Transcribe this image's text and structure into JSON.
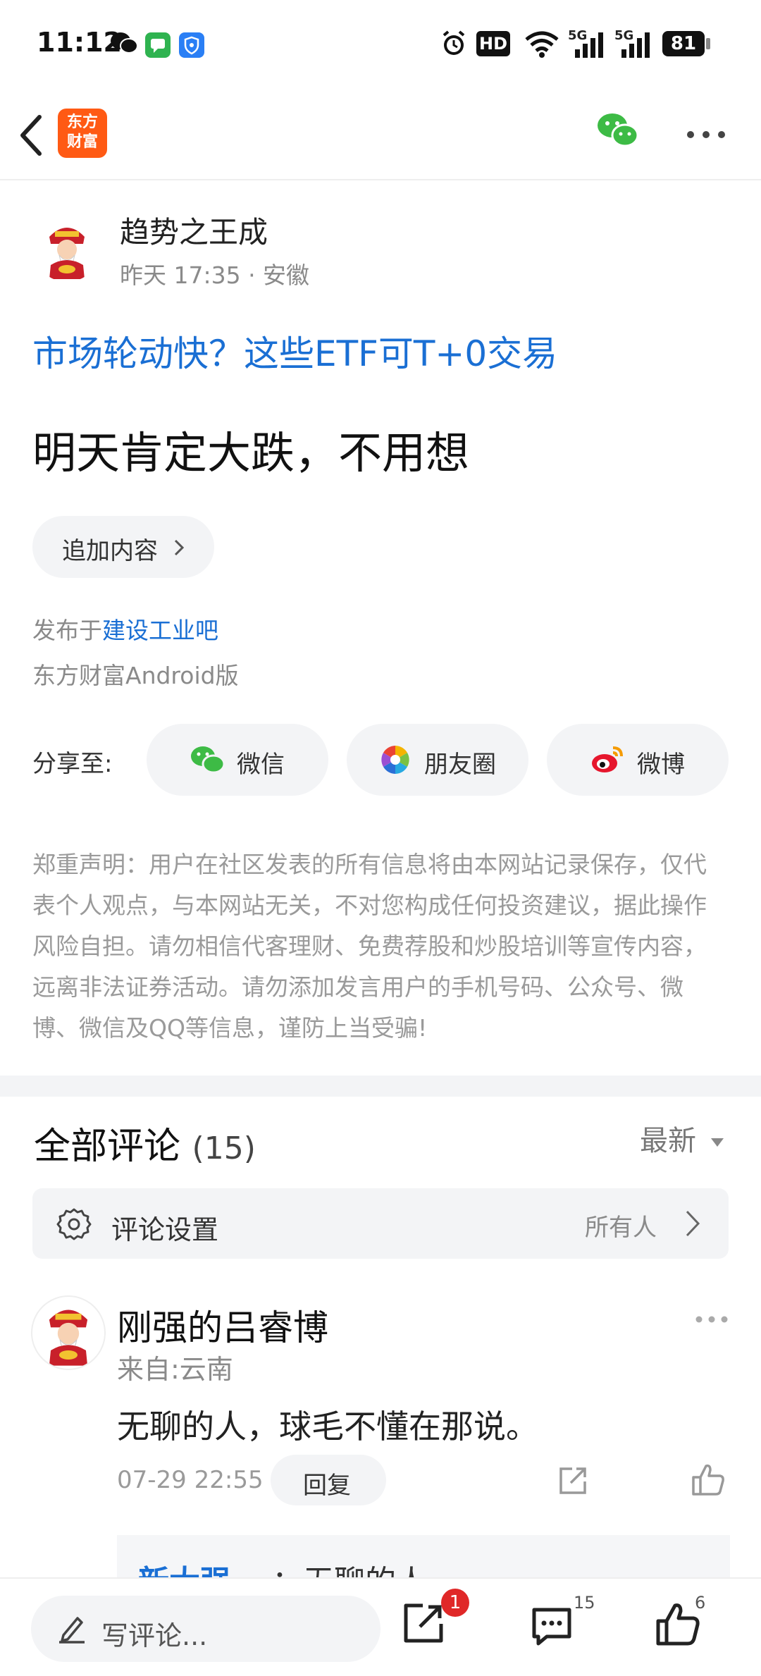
{
  "status_bar": {
    "time": "11:12",
    "battery": "81",
    "network_label_1": "5G",
    "network_label_2": "5G",
    "hd_label": "HD"
  },
  "nav": {
    "back_icon": "chevron-left-icon",
    "logo_text_line1": "东方",
    "logo_text_line2": "财富",
    "logo_color": "#ff5a14",
    "wechat_color": "#3dbb45"
  },
  "post": {
    "author_name": "趋势之王成",
    "author_meta": "昨天 17:35 · 安徽",
    "promo_link": "市场轮动快？这些ETF可T+0交易",
    "body_text": "明天肯定大跌，不用想",
    "add_content_label": "追加内容",
    "publish_prefix": "发布于",
    "publish_board": "建设工业吧",
    "client": "东方财富Android版"
  },
  "share": {
    "label": "分享至:",
    "targets": [
      {
        "label": "微信",
        "icon": "wechat-icon"
      },
      {
        "label": "朋友圈",
        "icon": "moments-icon"
      },
      {
        "label": "微博",
        "icon": "weibo-icon"
      }
    ]
  },
  "disclaimer": "郑重声明：用户在社区发表的所有信息将由本网站记录保存，仅代表个人观点，与本网站无关，不对您构成任何投资建议，据此操作风险自担。请勿相信代客理财、免费荐股和炒股培训等宣传内容，远离非法证券活动。请勿添加发言用户的手机号码、公众号、微博、微信及QQ等信息，谨防上当受骗!",
  "comments": {
    "title": "全部评论",
    "count": "(15)",
    "sort_label": "最新",
    "settings_label": "评论设置",
    "settings_value": "所有人",
    "items": [
      {
        "name": "刚强的吕睿博",
        "from": "来自:云南",
        "text": "无聊的人，球毛不懂在那说。",
        "time": "07-29 22:55",
        "reply_label": "回复",
        "nested_name": "新大强",
        "nested_text": "：无聊的人"
      }
    ]
  },
  "bottom_bar": {
    "write_placeholder": "写评论...",
    "share_badge": "1",
    "comment_count": "15",
    "like_count": "6"
  }
}
